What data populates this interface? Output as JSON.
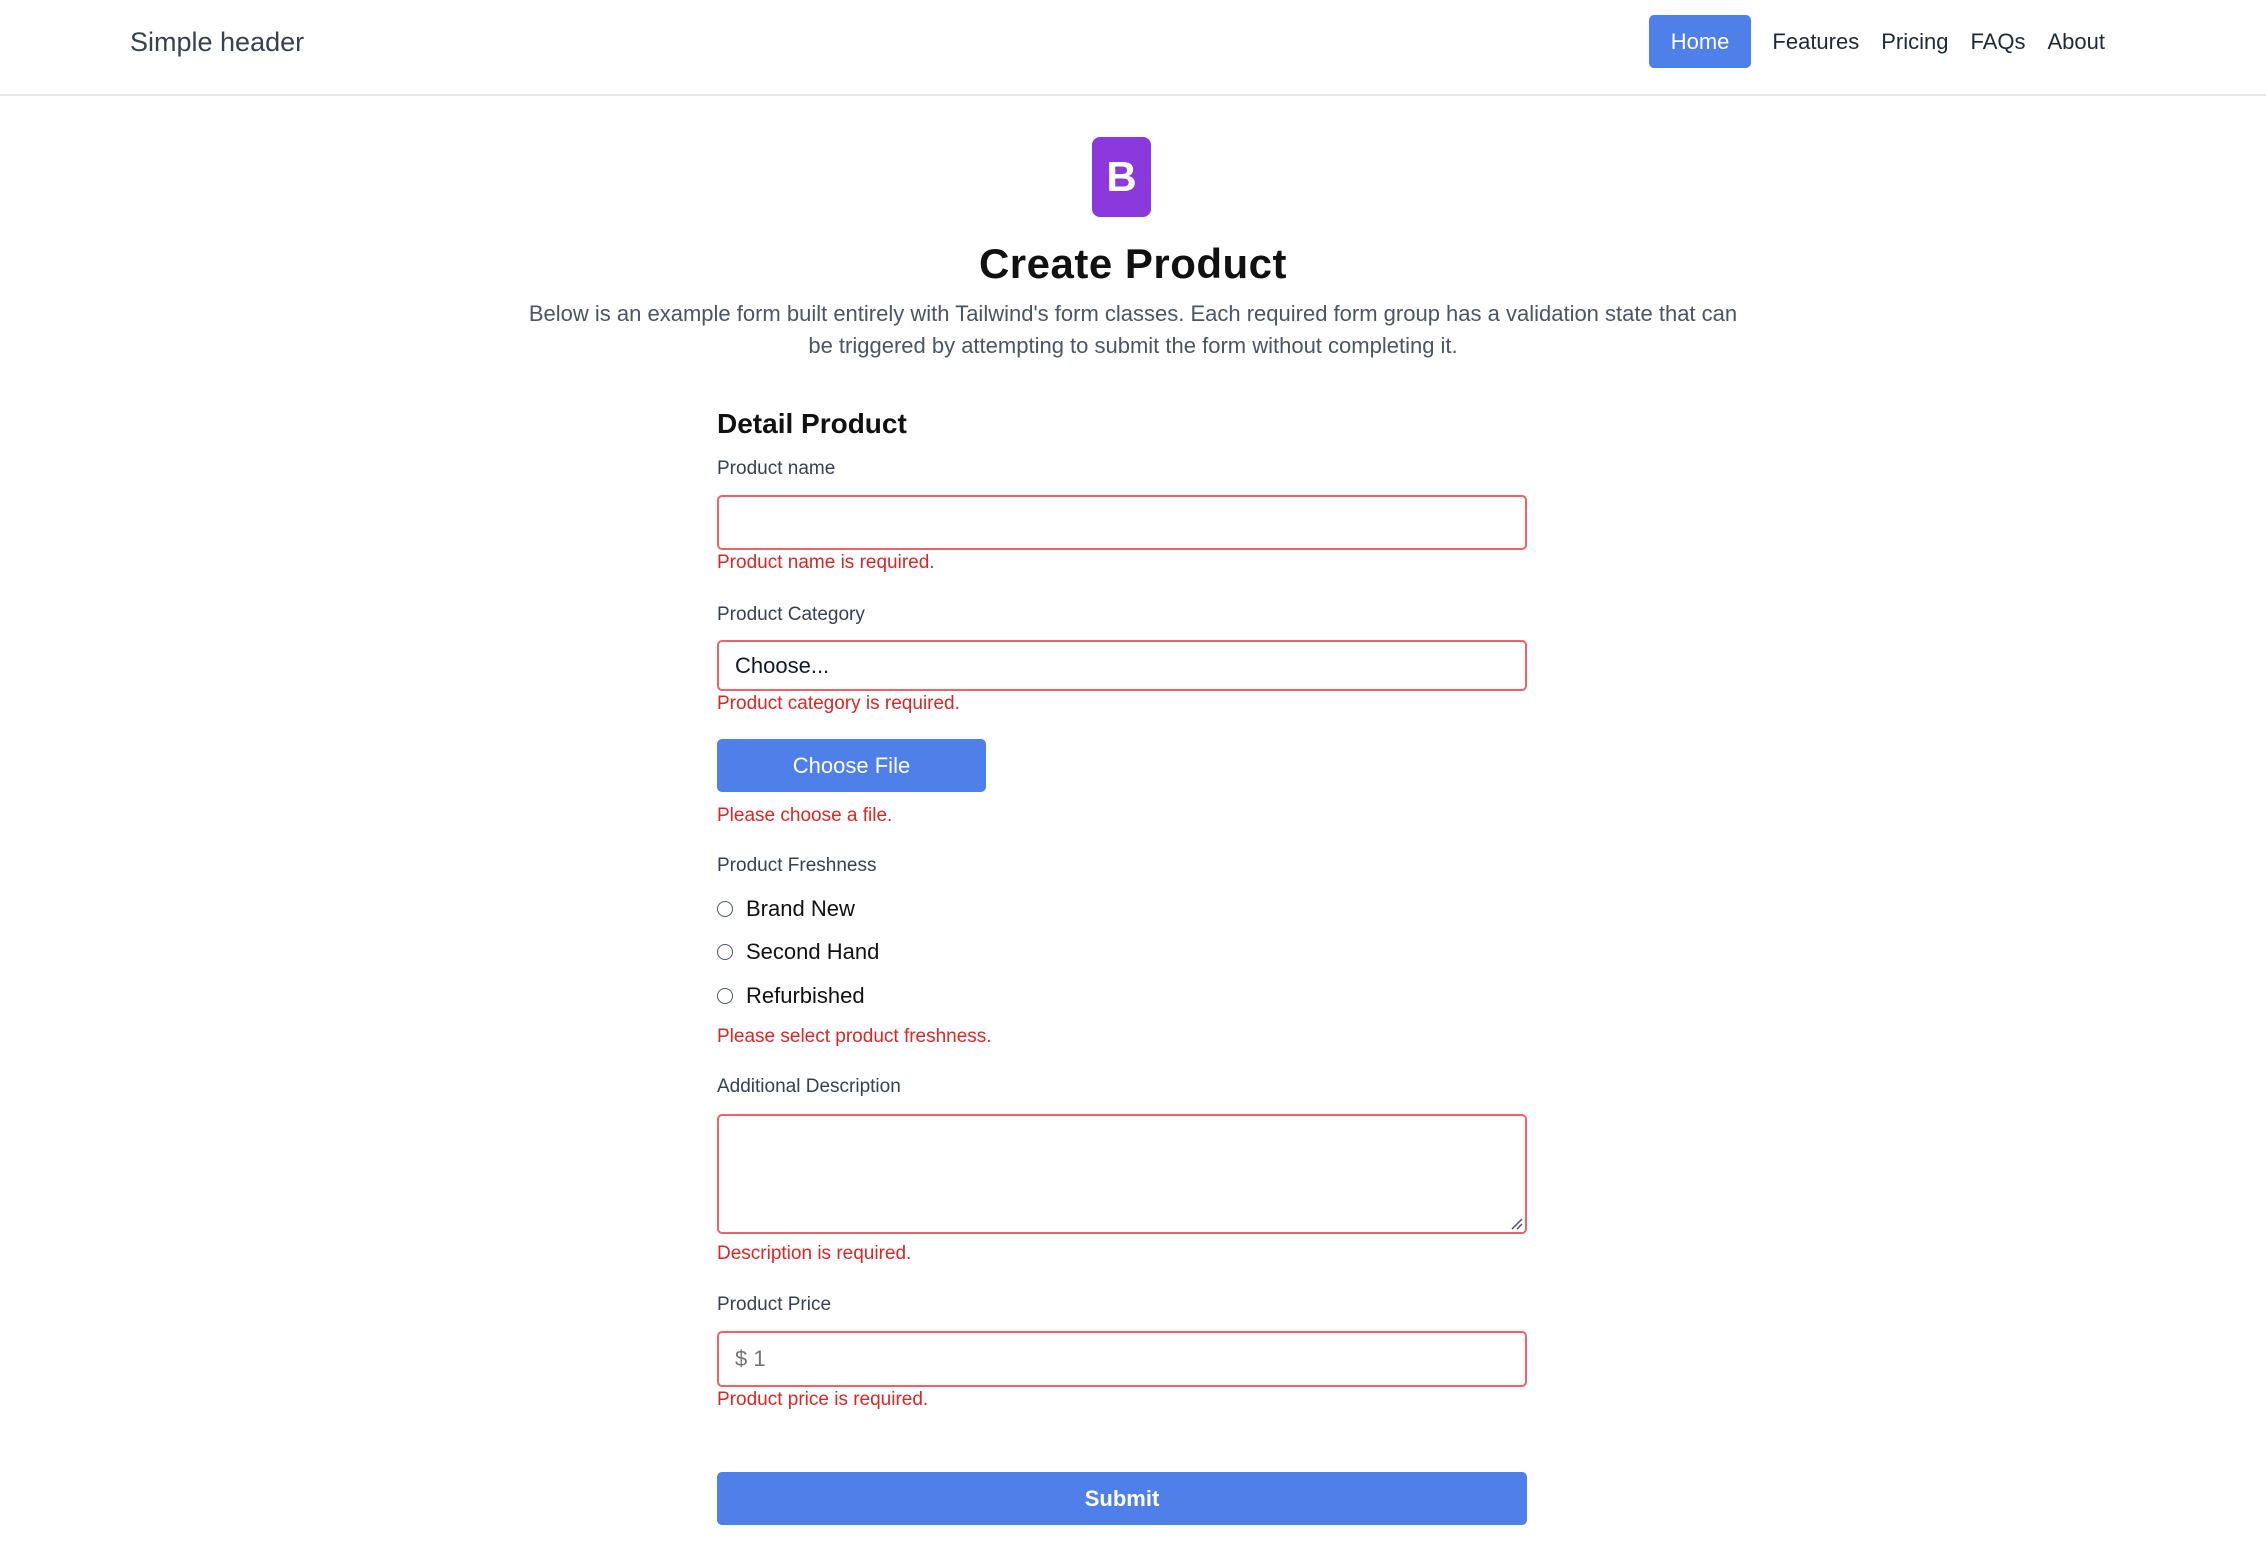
{
  "header": {
    "brand": "Simple header",
    "nav": [
      "Home",
      "Features",
      "Pricing",
      "FAQs",
      "About"
    ],
    "active": "Home"
  },
  "hero": {
    "logo_letter": "B",
    "logo_color": "#8b38dd",
    "title": "Create Product",
    "subtitle": "Below is an example form built entirely with Tailwind's form classes. Each required form group has a validation state that can be triggered by attempting to submit the form without completing it."
  },
  "form": {
    "section_title": "Detail Product",
    "product_name": {
      "label": "Product name",
      "value": "",
      "error": "Product name is required."
    },
    "category": {
      "label": "Product Category",
      "selected": "Choose...",
      "error": "Product category is required."
    },
    "file": {
      "button": "Choose File",
      "error": "Please choose a file."
    },
    "freshness": {
      "label": "Product Freshness",
      "options": [
        "Brand New",
        "Second Hand",
        "Refurbished"
      ],
      "error": "Please select product freshness."
    },
    "description": {
      "label": "Additional Description",
      "value": "",
      "error": "Description is required."
    },
    "price": {
      "label": "Product Price",
      "placeholder": "$ 1",
      "error": "Product price is required."
    },
    "submit": "Submit"
  },
  "colors": {
    "accent": "#4f80ea",
    "error": "#dc2626",
    "error_border": "#f1606b"
  }
}
